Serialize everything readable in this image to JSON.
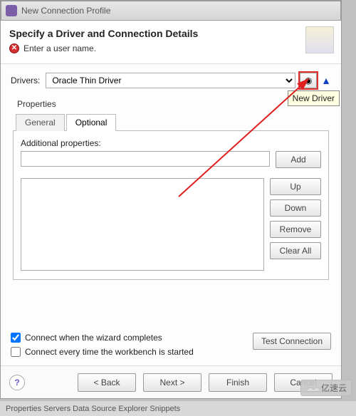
{
  "window": {
    "title": "New Connection Profile"
  },
  "header": {
    "title": "Specify a Driver and Connection Details",
    "error": "Enter a user name."
  },
  "drivers": {
    "label": "Drivers:",
    "selected": "Oracle Thin Driver",
    "new_driver_tooltip": "New Driver"
  },
  "properties": {
    "group_label": "Properties",
    "tabs": {
      "general": "General",
      "optional": "Optional"
    },
    "additional_label": "Additional properties:",
    "buttons": {
      "add": "Add",
      "up": "Up",
      "down": "Down",
      "remove": "Remove",
      "clear_all": "Clear All"
    }
  },
  "options": {
    "connect_when_complete": "Connect when the wizard completes",
    "connect_when_complete_checked": true,
    "connect_every_time": "Connect every time the workbench is started",
    "connect_every_time_checked": false,
    "test_connection": "Test Connection"
  },
  "footer": {
    "back": "< Back",
    "next": "Next >",
    "finish": "Finish",
    "cancel": "Cancel"
  },
  "watermark": "亿速云",
  "taskbar": "Properties   Servers   Data Source Explorer   Snippets"
}
